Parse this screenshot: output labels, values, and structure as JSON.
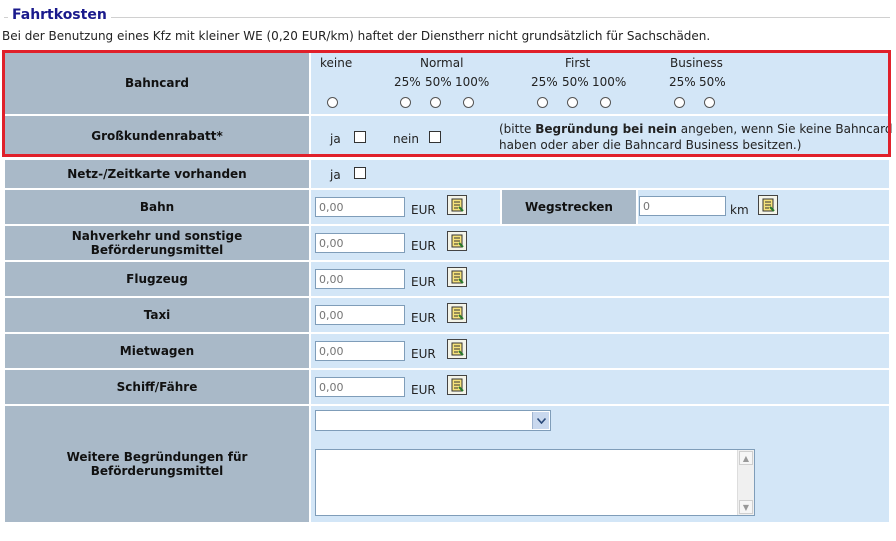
{
  "section": {
    "title": "Fahrtkosten",
    "note": "Bei der Benutzung eines Kfz mit kleiner WE (0,20 EUR/km) haftet der Dienstherr nicht grundsätzlich für Sachschäden."
  },
  "bahncard": {
    "label": "Bahncard",
    "groups": {
      "keine": "keine",
      "normal": "Normal",
      "first": "First",
      "business": "Business"
    },
    "pct": {
      "p25": "25%",
      "p50": "50%",
      "p100": "100%"
    }
  },
  "rabatt": {
    "label": "Großkundenrabatt*",
    "ja": "ja",
    "nein": "nein",
    "hint_pre": "(bitte ",
    "hint_bold": "Begründung bei nein",
    "hint_post": " angeben, wenn Sie keine Bahncard",
    "hint_line2": "haben oder aber die Bahncard Business besitzen.)"
  },
  "netzkarte": {
    "label": "Netz-/Zeitkarte vorhanden",
    "ja": "ja"
  },
  "rows": {
    "bahn": {
      "label": "Bahn",
      "placeholder": "0,00",
      "unit": "EUR"
    },
    "nahverkehr": {
      "label": "Nahverkehr und sonstige Beförderungsmittel",
      "placeholder": "0,00",
      "unit": "EUR"
    },
    "flugzeug": {
      "label": "Flugzeug",
      "placeholder": "0,00",
      "unit": "EUR"
    },
    "taxi": {
      "label": "Taxi",
      "placeholder": "0,00",
      "unit": "EUR"
    },
    "mietwagen": {
      "label": "Mietwagen",
      "placeholder": "0,00",
      "unit": "EUR"
    },
    "schiff": {
      "label": "Schiff/Fähre",
      "placeholder": "0,00",
      "unit": "EUR"
    }
  },
  "wegstrecken": {
    "label": "Wegstrecken",
    "placeholder": "0",
    "unit": "km"
  },
  "weitere": {
    "label": "Weitere Begründungen für Beförderungsmittel",
    "select_value": ""
  }
}
